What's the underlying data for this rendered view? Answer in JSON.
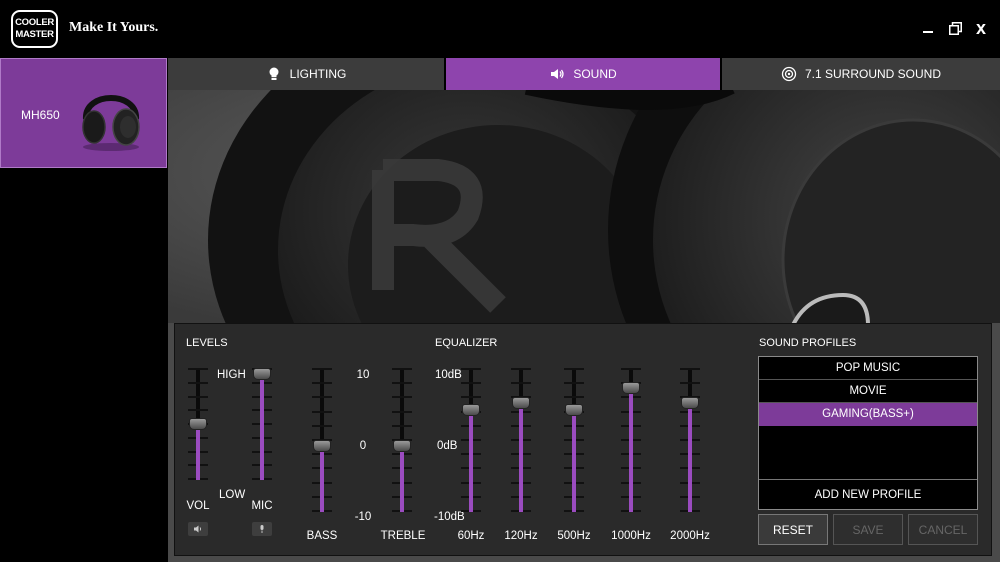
{
  "brand": {
    "logo_line1": "COOLER",
    "logo_line2": "MASTER",
    "tagline": "Make It Yours."
  },
  "window_controls": {
    "close_label": "x"
  },
  "sidebar": {
    "device_name": "MH650"
  },
  "tabs": [
    {
      "label": "LIGHTING",
      "icon": "bulb-icon",
      "active": false
    },
    {
      "label": "SOUND",
      "icon": "speaker-icon",
      "active": true
    },
    {
      "label": "7.1 SURROUND SOUND",
      "icon": "surround-icon",
      "active": false
    }
  ],
  "levels": {
    "title": "LEVELS",
    "vol_label": "VOL",
    "mic_label": "MIC",
    "high_label": "HIGH",
    "low_label": "LOW",
    "vol_level": 0.55,
    "mic_level": 1.0
  },
  "tone": {
    "bass_label": "BASS",
    "treble_label": "TREBLE",
    "scale_top": "10",
    "scale_mid": "0",
    "scale_bottom": "-10",
    "bass_value": 0,
    "treble_value": 0
  },
  "equalizer": {
    "title": "EQUALIZER",
    "scale_top": "10dB",
    "scale_mid": "0dB",
    "scale_bottom": "-10dB",
    "bands": [
      {
        "label": "60Hz",
        "value": 5
      },
      {
        "label": "120Hz",
        "value": 6
      },
      {
        "label": "500Hz",
        "value": 5
      },
      {
        "label": "1000Hz",
        "value": 8
      },
      {
        "label": "2000Hz",
        "value": 6
      }
    ]
  },
  "sound_profiles": {
    "title": "SOUND PROFILES",
    "items": [
      "POP MUSIC",
      "MOVIE",
      "GAMING(BASS+)"
    ],
    "selected_index": 2,
    "add_label": "ADD NEW PROFILE",
    "reset_label": "RESET",
    "save_label": "SAVE",
    "cancel_label": "CANCEL"
  },
  "colors": {
    "accent": "#8e44ad",
    "panel": "#2a2a2a",
    "tab_inactive": "#3c3c3c"
  }
}
